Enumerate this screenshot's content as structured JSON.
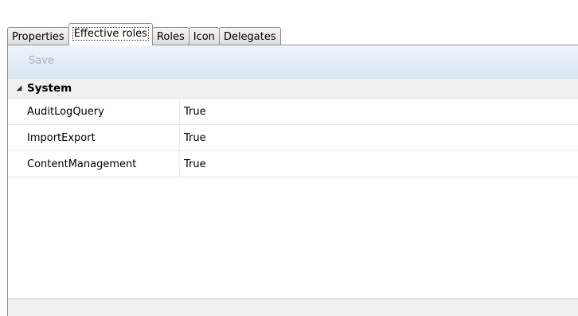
{
  "tabs": [
    {
      "label": "Properties",
      "active": false
    },
    {
      "label": "Effective roles",
      "active": true
    },
    {
      "label": "Roles",
      "active": false
    },
    {
      "label": "Icon",
      "active": false
    },
    {
      "label": "Delegates",
      "active": false
    }
  ],
  "toolbar": {
    "save_label": "Save"
  },
  "group": {
    "label": "System",
    "expanded_icon": "triangle-down-icon"
  },
  "rows": [
    {
      "name": "AuditLogQuery",
      "value": "True"
    },
    {
      "name": "ImportExport",
      "value": "True"
    },
    {
      "name": "ContentManagement",
      "value": "True"
    }
  ]
}
